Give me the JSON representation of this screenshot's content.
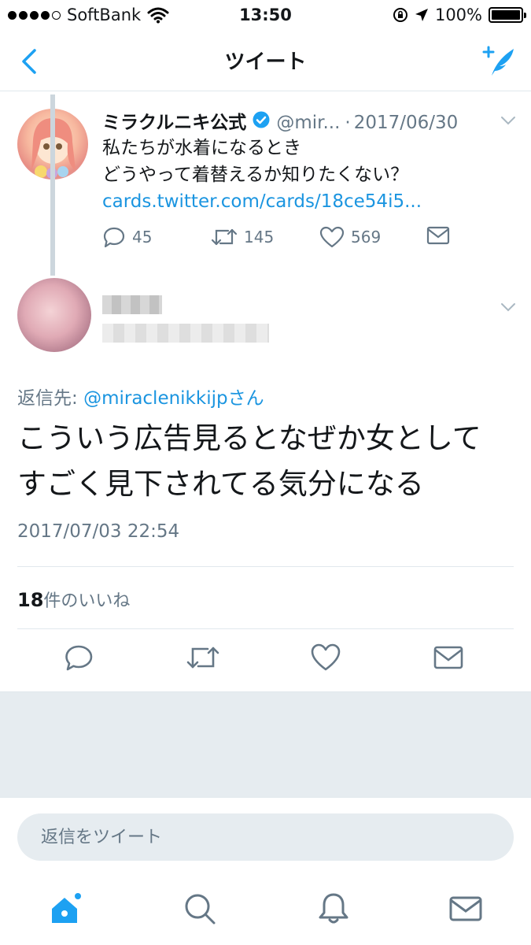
{
  "status_bar": {
    "carrier": "SoftBank",
    "time": "13:50",
    "battery": "100%"
  },
  "nav": {
    "title": "ツイート"
  },
  "original_tweet": {
    "name": "ミラクルニキ公式",
    "handle": "@mir...",
    "separator": "·",
    "date": "2017/06/30",
    "text_line1": "私たちが水着になるとき",
    "text_line2": "どうやって着替えるか知りたくない？",
    "link": "cards.twitter.com/cards/18ce54i5...",
    "replies": "45",
    "retweets": "145",
    "likes": "569"
  },
  "reply_tweet": {
    "reply_to_label": "返信先: ",
    "reply_to_mention": "@miraclenikkijpさん",
    "text_line1": "こういう広告見るとなぜか女として",
    "text_line2": "すごく見下されてる気分になる",
    "timestamp": "2017/07/03 22:54",
    "like_count": "18",
    "like_label": "件のいいね"
  },
  "compose": {
    "placeholder": "返信をツイート"
  },
  "colors": {
    "accent": "#1da1f2",
    "link": "#1b95e0",
    "muted": "#657786",
    "background_gray": "#e6ecf0"
  },
  "icons": {
    "back": "chevron-left-icon",
    "compose": "compose-quill-icon",
    "verified": "verified-badge-icon",
    "reply": "reply-icon",
    "retweet": "retweet-icon",
    "like": "heart-icon",
    "dm": "envelope-icon",
    "home": "home-icon",
    "search": "search-icon",
    "notifications": "bell-icon",
    "messages": "envelope-icon"
  }
}
